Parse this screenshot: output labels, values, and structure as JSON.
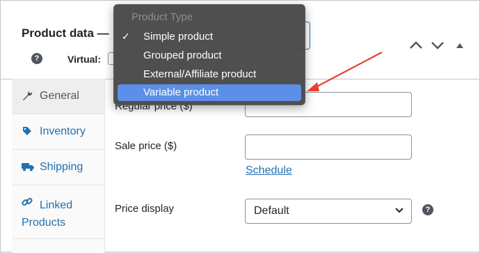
{
  "panel": {
    "title": "Product data —",
    "virtual_label": "Virtual:"
  },
  "dropdown": {
    "header": "Product Type",
    "items": [
      {
        "label": "Simple product",
        "checked": true
      },
      {
        "label": "Grouped product",
        "checked": false
      },
      {
        "label": "External/Affiliate product",
        "checked": false
      },
      {
        "label": "Variable product",
        "checked": false,
        "highlighted": true
      }
    ],
    "check_glyph": "✓"
  },
  "tabs": [
    {
      "label": "General",
      "icon": "wrench-icon",
      "active": true
    },
    {
      "label": "Inventory",
      "icon": "tag-icon"
    },
    {
      "label": "Shipping",
      "icon": "truck-icon"
    },
    {
      "label": "Linked Products",
      "icon": "link-icon"
    }
  ],
  "fields": {
    "regular_price_label": "Regular price ($)",
    "sale_price_label": "Sale price ($)",
    "schedule_link": "Schedule",
    "price_display_label": "Price display",
    "price_display_value": "Default"
  },
  "colors": {
    "link": "#2271b1",
    "highlight": "#5c8fe8",
    "annotation_arrow": "#e8402f"
  }
}
